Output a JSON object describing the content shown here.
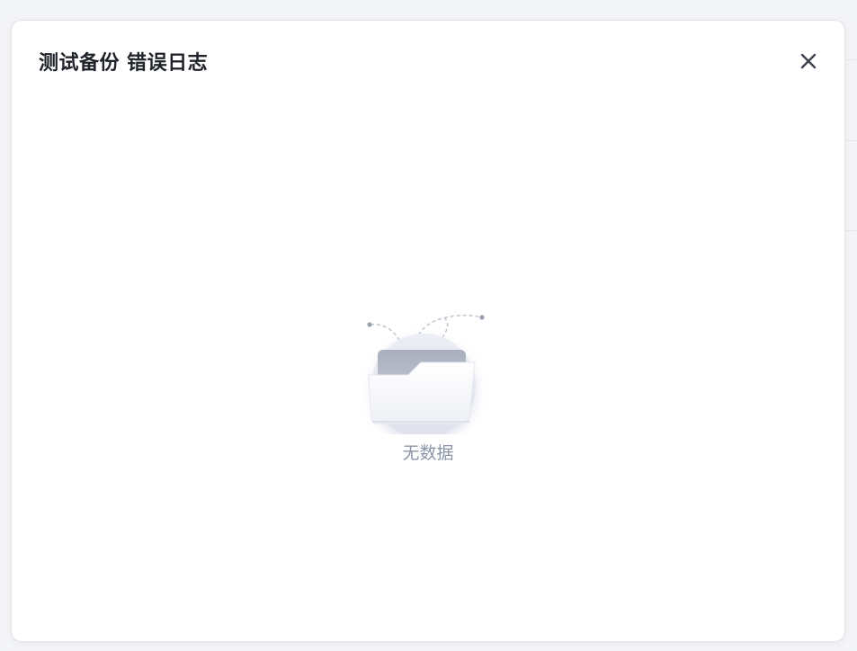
{
  "modal": {
    "title": "测试备份 错误日志",
    "close_icon": "close-icon"
  },
  "empty_state": {
    "illustration_icon": "empty-folder-icon",
    "text": "无数据"
  },
  "colors": {
    "title": "#1f2329",
    "empty_text": "#8b95a7",
    "close_icon": "#3c4350"
  }
}
